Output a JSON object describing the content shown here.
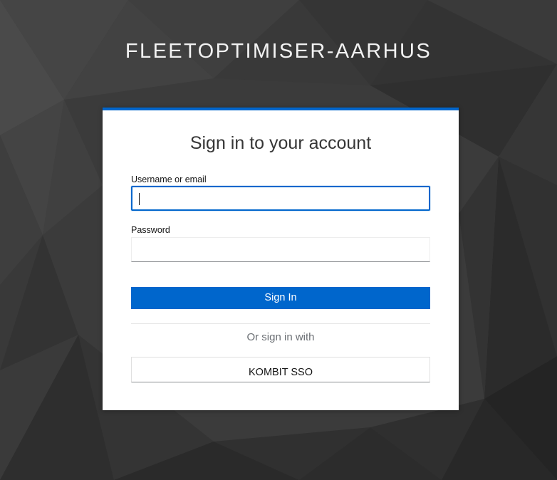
{
  "realm": {
    "title": "FLEETOPTIMISER-AARHUS"
  },
  "login": {
    "title": "Sign in to your account",
    "username_label": "Username or email",
    "username_value": "",
    "password_label": "Password",
    "password_value": "",
    "sign_in_label": "Sign In",
    "or_sign_in_with": "Or sign in with",
    "providers": [
      {
        "label": "KOMBIT SSO"
      }
    ]
  },
  "colors": {
    "accent": "#0066cc",
    "background": "#3a3a3a",
    "card": "#ffffff"
  }
}
